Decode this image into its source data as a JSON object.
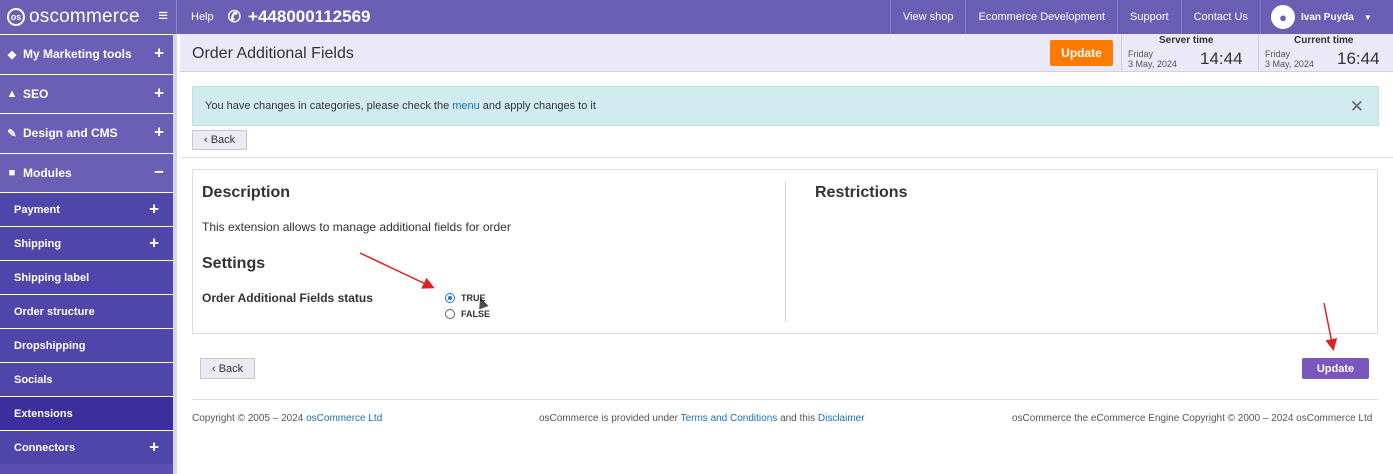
{
  "topbar": {
    "brand": "oscommerce",
    "brand_logo": "os",
    "help": "Help",
    "phone": "+448000112569",
    "links": [
      "View shop",
      "Ecommerce Development",
      "Support",
      "Contact Us"
    ],
    "user": "Ivan Puyda",
    "menu_icon": "≡"
  },
  "sidebar": {
    "items": [
      {
        "label": "My Marketing tools",
        "icon": "tag-icon",
        "toggle": "+"
      },
      {
        "label": "SEO",
        "icon": "sitemap-icon",
        "toggle": "+"
      },
      {
        "label": "Design and CMS",
        "icon": "brush-icon",
        "toggle": "+"
      },
      {
        "label": "Modules",
        "icon": "puzzle-icon",
        "toggle": "−"
      }
    ],
    "subitems": [
      {
        "label": "Payment",
        "toggle": "+"
      },
      {
        "label": "Shipping",
        "toggle": "+"
      },
      {
        "label": "Shipping label",
        "toggle": ""
      },
      {
        "label": "Order structure",
        "toggle": ""
      },
      {
        "label": "Dropshipping",
        "toggle": ""
      },
      {
        "label": "Socials",
        "toggle": ""
      },
      {
        "label": "Extensions",
        "toggle": ""
      },
      {
        "label": "Connectors",
        "toggle": "+"
      }
    ]
  },
  "header": {
    "title": "Order Additional Fields",
    "update_label": "Update",
    "server_time": {
      "label": "Server time",
      "day": "Friday",
      "date": "3 May, 2024",
      "time": "14:44"
    },
    "current_time": {
      "label": "Current time",
      "day": "Friday",
      "date": "3 May, 2024",
      "time": "16:44"
    }
  },
  "alert": {
    "text_before": "You have changes in categories, please check the",
    "link": "menu",
    "text_after": "and apply changes to it",
    "close": "✕"
  },
  "back_label": "‹ Back",
  "panel": {
    "description_heading": "Description",
    "description_text": "This extension allows to manage additional fields for order",
    "settings_heading": "Settings",
    "field_label": "Order Additional Fields status",
    "options": [
      "TRUE",
      "FALSE"
    ],
    "selected": "TRUE",
    "restrictions_heading": "Restrictions"
  },
  "update_bottom_label": "Update",
  "footer": {
    "left_text": "Copyright © 2005 – 2024",
    "left_link": "osCommerce Ltd",
    "center_text1": "osCommerce is provided under",
    "center_link1": "Terms and Conditions",
    "center_text2": "and this",
    "center_link2": "Disclaimer",
    "right_text": "osCommerce the eCommerce Engine Copyright © 2000 – 2024 osCommerce Ltd"
  },
  "colors": {
    "primary": "#6a5eb5",
    "sidebar_sub": "#5045a8",
    "sidebar_active": "#3c2f9c",
    "update_orange": "#ff7b00",
    "update_purple": "#7a57bd",
    "alert_bg": "#d1ecf1",
    "annotation_arrow": "#e02020"
  }
}
